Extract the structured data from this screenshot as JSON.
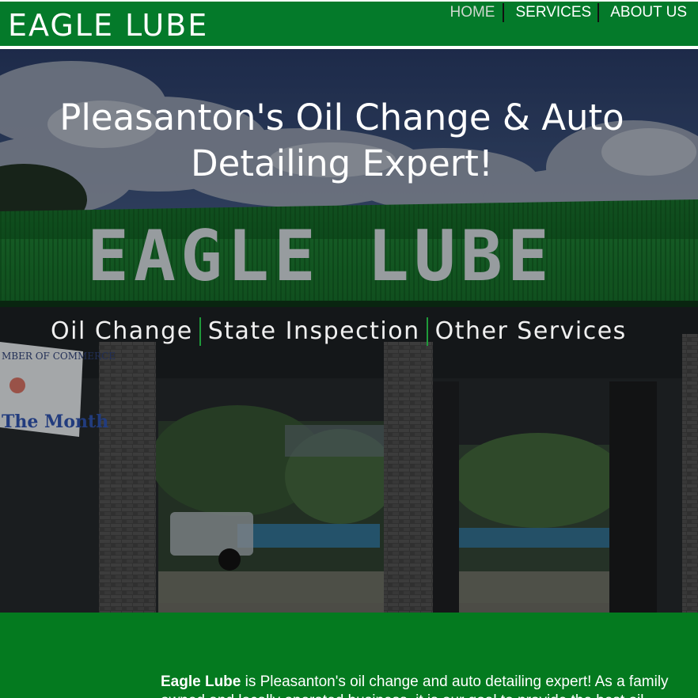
{
  "brand": {
    "name": "EAGLE LUBE"
  },
  "nav": {
    "items": [
      {
        "label": "HOME",
        "active": true
      },
      {
        "label": "SERVICES",
        "active": false
      },
      {
        "label": "ABOUT US",
        "active": false
      }
    ]
  },
  "hero": {
    "title": "Pleasanton's Oil Change & Auto Detailing Expert!",
    "sign_text": "EAGLE LUBE",
    "banner_lines": [
      "MBER OF COMMERCE",
      "The Month"
    ],
    "links": [
      {
        "label": "Oil Change"
      },
      {
        "label": "State Inspection"
      },
      {
        "label": "Other Services"
      }
    ]
  },
  "intro": {
    "bold": "Eagle Lube",
    "text": " is Pleasanton's oil change and auto detailing expert! As a family owned and locally operated business, it is our goal to provide the best oil"
  },
  "colors": {
    "header_green": "#047a2a",
    "section_green": "#047a1f",
    "sign_green": "#1f9a3a",
    "text_white": "#ffffff"
  }
}
